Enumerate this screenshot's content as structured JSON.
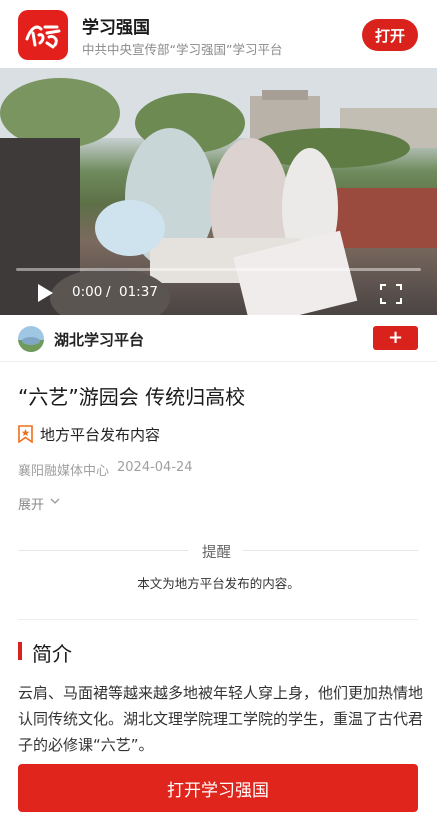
{
  "app_banner": {
    "logo_icon": "xuexi-logo-icon",
    "app_name": "学习强国",
    "subtitle": "中共中央宣传部“学习强国”学习平台",
    "open_label": "打开",
    "accent_color": "#d9221c"
  },
  "video": {
    "progress": 0,
    "current_time": "0:00",
    "separator": "/",
    "total_time": "01:37",
    "play_icon": "play-icon",
    "fullscreen_icon": "fullscreen-icon"
  },
  "channel": {
    "name": "湖北学习平台",
    "follow_label": "+"
  },
  "article": {
    "title": "“六艺”游园会 传统归高校",
    "source_icon": "bookmark-icon",
    "source_label": "地方平台发布内容",
    "publisher": "襄阳融媒体中心",
    "date": "2024-04-24",
    "expand_label": "展开"
  },
  "notice": {
    "title": "提醒",
    "body": "本文为地方平台发布的内容。"
  },
  "intro": {
    "heading": "简介",
    "text": "云肩、马面裙等越来越多地被年轻人穿上身，他们更加热情地认同传统文化。湖北文理学院理工学院的学生，重温了古代君子的必修课“六艺”。"
  },
  "cta": {
    "label": "打开学习强国"
  }
}
